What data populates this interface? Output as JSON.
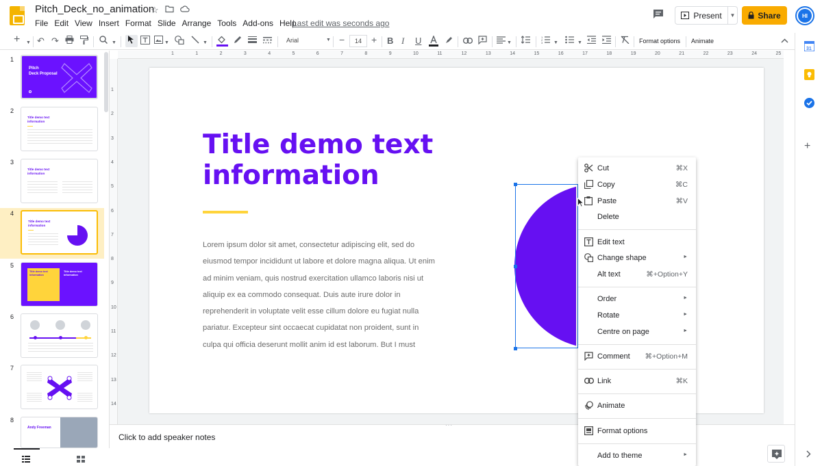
{
  "app": {
    "doc_title": "Pitch_Deck_no_animation",
    "menu": [
      "File",
      "Edit",
      "View",
      "Insert",
      "Format",
      "Slide",
      "Arrange",
      "Tools",
      "Add-ons",
      "Help"
    ],
    "last_edit": "Last edit was seconds ago",
    "present_label": "Present",
    "share_label": "Share",
    "avatar_initials": "HI"
  },
  "toolbar": {
    "font_name": "Arial",
    "font_size": "14",
    "format_options": "Format options",
    "animate": "Animate"
  },
  "ruler": {
    "numbers": [
      "1",
      "1",
      "2",
      "3",
      "4",
      "5",
      "6",
      "7",
      "8",
      "9",
      "10",
      "11",
      "12",
      "13",
      "14",
      "15",
      "16",
      "17",
      "18",
      "19",
      "20",
      "21",
      "22",
      "23",
      "24",
      "25"
    ],
    "vnumbers": [
      "1",
      "2",
      "3",
      "4",
      "5",
      "6",
      "7",
      "8",
      "9",
      "10",
      "11",
      "12",
      "13",
      "14"
    ]
  },
  "filmstrip": {
    "slides": [
      {
        "num": "1",
        "text": "Pitch\nDeck Proposal"
      },
      {
        "num": "2",
        "text": "Title demo text information"
      },
      {
        "num": "3",
        "text": "Title demo text information"
      },
      {
        "num": "4",
        "text": "Title demo text information"
      },
      {
        "num": "5",
        "text": "Title demo text information"
      },
      {
        "num": "6",
        "text": ""
      },
      {
        "num": "7",
        "text": ""
      },
      {
        "num": "8",
        "text": "Andy Freeman"
      }
    ]
  },
  "slide": {
    "title": "Title demo text information",
    "body": "Lorem ipsum dolor sit amet, consectetur adipiscing elit, sed do eiusmod tempor incididunt ut labore et dolore magna aliqua. Ut enim ad minim veniam, quis nostrud exercitation ullamco laboris nisi ut aliquip ex ea commodo consequat. Duis aute irure dolor in reprehenderit in voluptate velit esse cillum dolore eu fugiat nulla pariatur. Excepteur sint occaecat cupidatat non proident, sunt in culpa qui officia deserunt mollit anim id est laborum. But I must"
  },
  "notes": {
    "placeholder": "Click to add speaker notes"
  },
  "context_menu": {
    "cut": {
      "label": "Cut",
      "shortcut": "⌘X"
    },
    "copy": {
      "label": "Copy",
      "shortcut": "⌘C"
    },
    "paste": {
      "label": "Paste",
      "shortcut": "⌘V"
    },
    "delete": {
      "label": "Delete"
    },
    "edit_text": {
      "label": "Edit text"
    },
    "change_shape": {
      "label": "Change shape"
    },
    "alt_text": {
      "label": "Alt text",
      "shortcut": "⌘+Option+Y"
    },
    "order": {
      "label": "Order"
    },
    "rotate": {
      "label": "Rotate"
    },
    "centre": {
      "label": "Centre on page"
    },
    "comment": {
      "label": "Comment",
      "shortcut": "⌘+Option+M"
    },
    "link": {
      "label": "Link",
      "shortcut": "⌘K"
    },
    "animate": {
      "label": "Animate"
    },
    "format_options": {
      "label": "Format options"
    },
    "add_to_theme": {
      "label": "Add to theme"
    }
  },
  "colors": {
    "accent_purple": "#6610f2",
    "accent_yellow": "#FFD43B",
    "share_yellow": "#F9AB00",
    "selection_blue": "#1a73e8"
  }
}
